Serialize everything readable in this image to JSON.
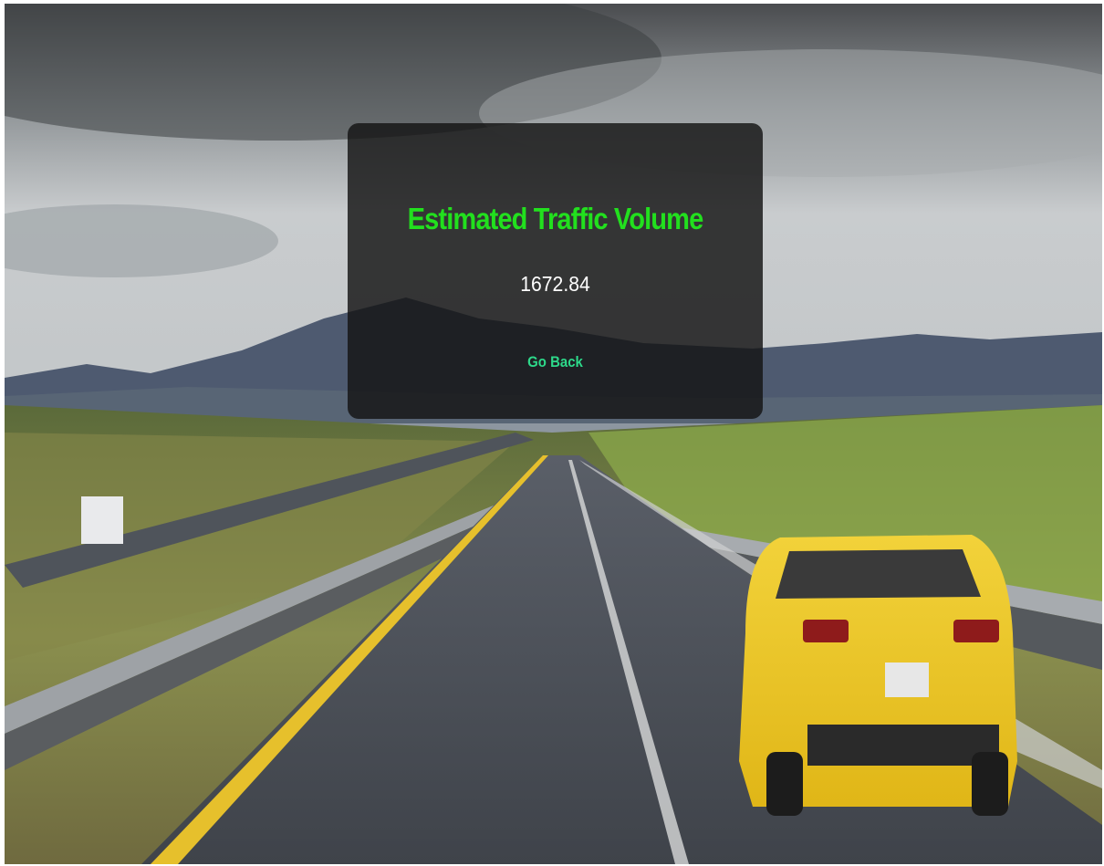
{
  "result_card": {
    "title": "Estimated Traffic Volume",
    "value": "1672.84",
    "back_link": "Go Back"
  },
  "background": {
    "scene": "highway-landscape-photo"
  },
  "colors": {
    "title": "#22e01e",
    "value": "#ffffff",
    "link": "#2dd98a",
    "card_bg": "rgba(20,20,20,0.82)"
  }
}
